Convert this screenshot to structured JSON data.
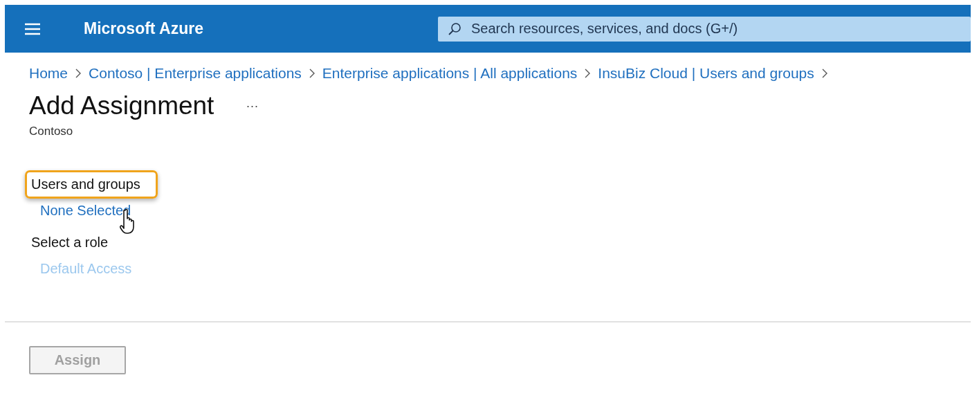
{
  "header": {
    "title": "Microsoft Azure",
    "search": {
      "placeholder": "Search resources, services, and docs (G+/)"
    }
  },
  "breadcrumbs": [
    "Home",
    "Contoso | Enterprise applications",
    "Enterprise applications | All applications",
    "InsuBiz Cloud | Users and groups"
  ],
  "page": {
    "title": "Add Assignment",
    "more": "···",
    "subtitle": "Contoso"
  },
  "sections": [
    {
      "label": "Users and groups",
      "highlighted": true,
      "value": "None Selected",
      "disabled": false,
      "cursor": true
    },
    {
      "label": "Select a role",
      "highlighted": false,
      "value": "Default Access",
      "disabled": true,
      "cursor": false
    }
  ],
  "footer": {
    "button": {
      "label": "Assign",
      "disabled": true
    }
  }
}
